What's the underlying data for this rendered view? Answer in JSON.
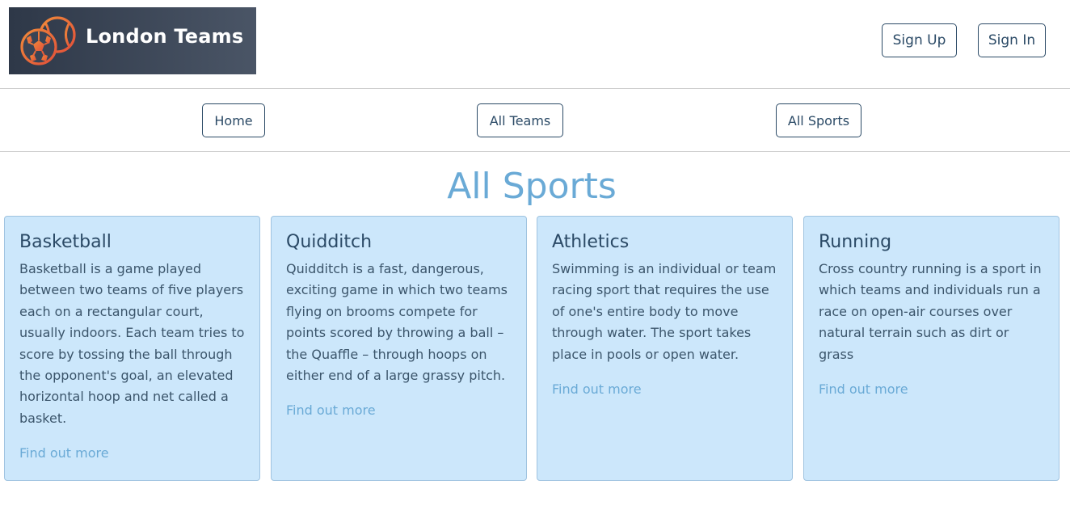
{
  "header": {
    "logo_text": "London Teams",
    "sign_up": "Sign Up",
    "sign_in": "Sign In"
  },
  "nav": {
    "home": "Home",
    "all_teams": "All Teams",
    "all_sports": "All Sports"
  },
  "main": {
    "title": "All Sports",
    "cards": [
      {
        "title": "Basketball",
        "text": "Basketball is a game played between two teams of five players each on a rectangular court, usually indoors. Each team tries to score by tossing the ball through the opponent's goal, an elevated horizontal hoop and net called a basket.",
        "link": "Find out more"
      },
      {
        "title": "Quidditch",
        "text": "Quidditch is a fast, dangerous, exciting game in which two teams flying on brooms compete for points scored by throwing a ball – the Quaffle – through hoops on either end of a large grassy pitch.",
        "link": "Find out more"
      },
      {
        "title": "Athletics",
        "text": "Swimming is an individual or team racing sport that requires the use of one's entire body to move through water. The sport takes place in pools or open water.",
        "link": "Find out more"
      },
      {
        "title": "Running",
        "text": "Cross country running is a sport in which teams and individuals run a race on open-air courses over natural terrain such as dirt or grass",
        "link": "Find out more"
      }
    ]
  },
  "colors": {
    "primary": "#2b4a66",
    "accent": "#6aaad6",
    "card_background": "#cce7fb",
    "logo_ball": "#e8663a"
  }
}
